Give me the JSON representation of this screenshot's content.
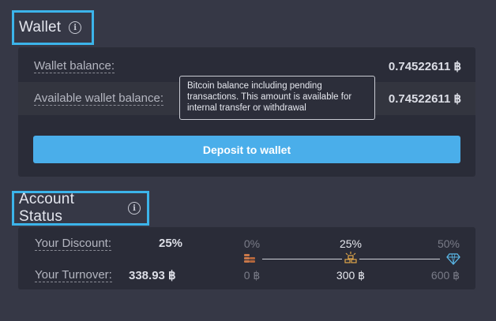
{
  "wallet": {
    "title": "Wallet",
    "balance_label": "Wallet balance:",
    "balance_value": "0.74522611 ฿",
    "available_label": "Available wallet balance:",
    "available_value": "0.74522611 ฿",
    "tooltip_lines": [
      "Bitcoin balance including pending",
      "transactions. This amount is available for",
      "internal transfer or withdrawal"
    ],
    "deposit_button": "Deposit to wallet"
  },
  "account_status": {
    "title": "Account Status",
    "discount_label": "Your Discount:",
    "discount_value": "25%",
    "turnover_label": "Your Turnover:",
    "turnover_value": "338.93 ฿",
    "tiers": [
      {
        "percent": "0%",
        "amount": "0 ฿",
        "icon": "bronze-coins-icon",
        "state": "past"
      },
      {
        "percent": "25%",
        "amount": "300 ฿",
        "icon": "gold-bars-icon",
        "state": "current"
      },
      {
        "percent": "50%",
        "amount": "600 ฿",
        "icon": "diamond-icon",
        "state": "next"
      }
    ]
  },
  "colors": {
    "accent": "#3cb4ea",
    "button": "#4aaeea",
    "background": "#363846",
    "panel": "#2a2c38",
    "bronze": "#c8784a",
    "gold": "#e0a64a",
    "diamond": "#5ab8e8"
  }
}
